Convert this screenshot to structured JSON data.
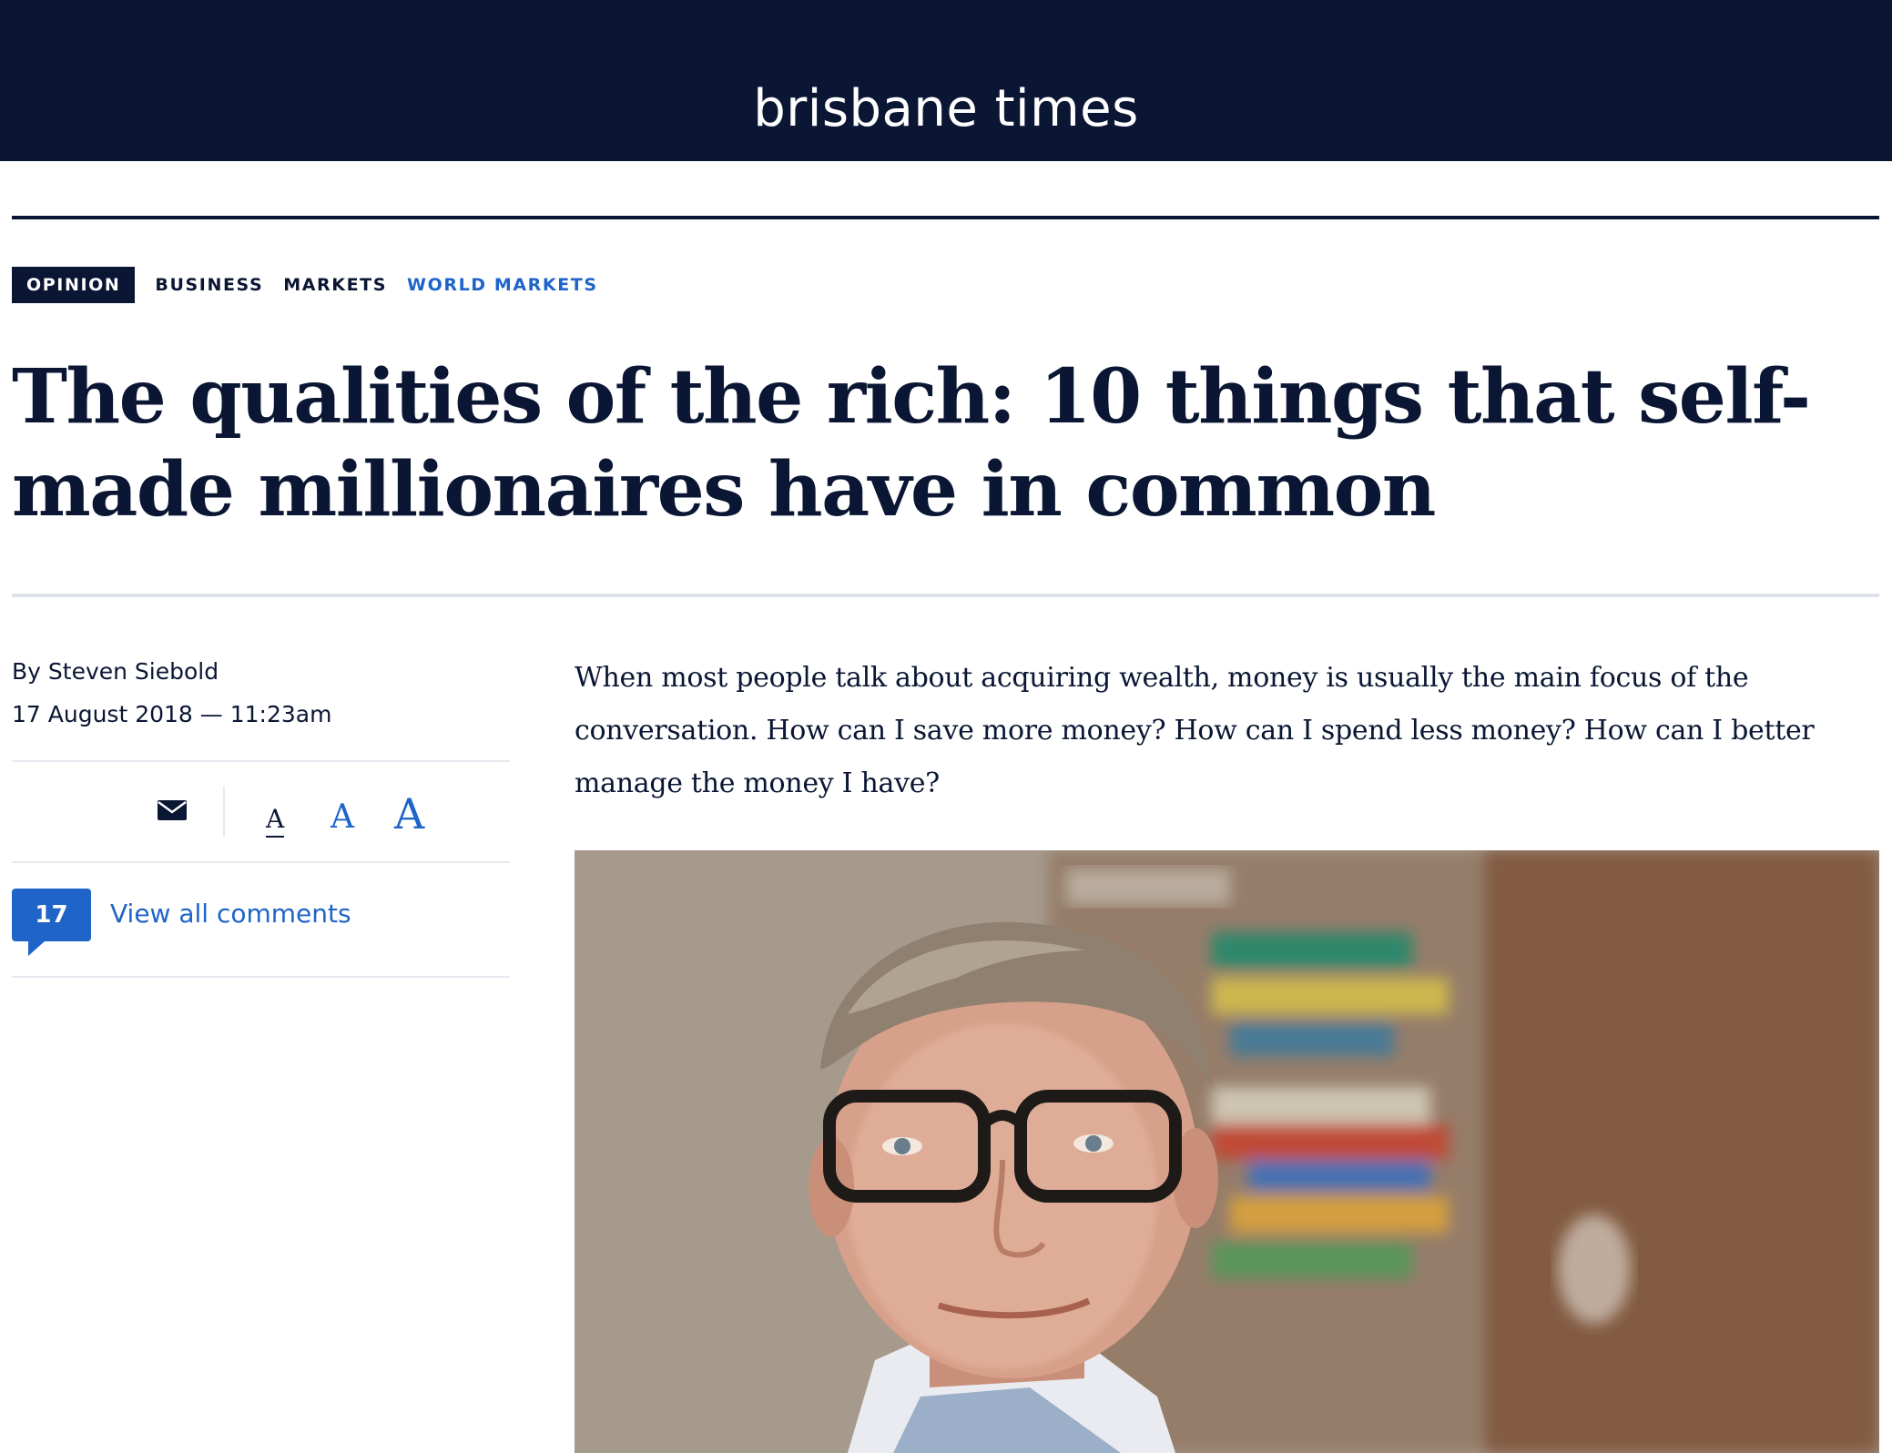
{
  "site": {
    "name": "brisbane times"
  },
  "tags": [
    {
      "label": "OPINION"
    },
    {
      "label": "BUSINESS"
    },
    {
      "label": "MARKETS"
    },
    {
      "label": "WORLD MARKETS"
    }
  ],
  "article": {
    "headline": "The qualities of the rich: 10 things that self-made millionaires have in common",
    "byline_prefix": "By",
    "author": "Steven Siebold",
    "date": "17 August 2018 — 11:23am",
    "intro": "When most people talk about acquiring wealth, money is usually the main focus of the conversation. How can I save more money? How can I spend less money? How can I better manage the money I have?"
  },
  "tools": {
    "email_icon": "envelope-icon",
    "font_sizes": [
      "A",
      "A",
      "A"
    ]
  },
  "comments": {
    "count": "17",
    "label": "View all comments"
  },
  "colors": {
    "navy": "#0a1633",
    "accent_blue": "#1f64c8"
  }
}
